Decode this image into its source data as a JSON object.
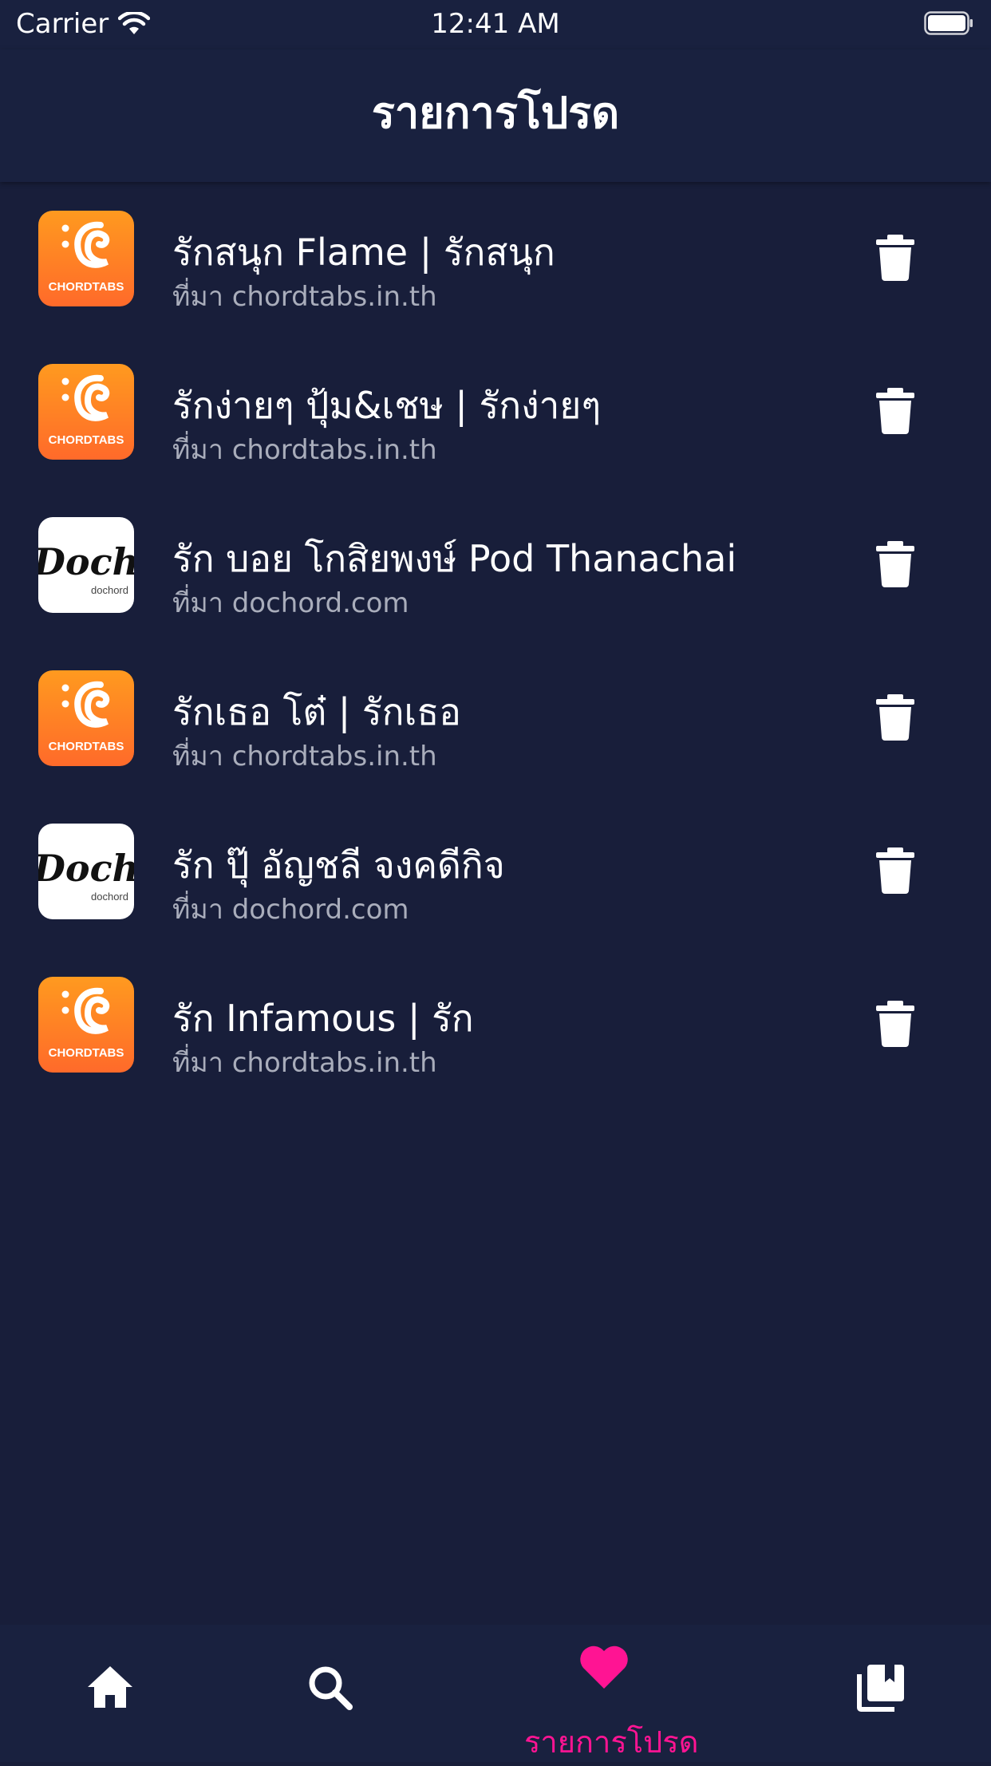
{
  "status_bar": {
    "carrier": "Carrier",
    "time": "12:41 AM"
  },
  "header": {
    "title": "รายการโปรด"
  },
  "favorites": [
    {
      "title": "รักสนุก Flame | รักสนุก",
      "source": "ที่มา chordtabs.in.th",
      "logo": "chordtabs"
    },
    {
      "title": "รักง่ายๆ ปุ้ม&เชษ | รักง่ายๆ",
      "source": "ที่มา chordtabs.in.th",
      "logo": "chordtabs"
    },
    {
      "title": "รัก บอย โกสิยพงษ์ Pod Thanachai",
      "source": "ที่มา dochord.com",
      "logo": "dochord"
    },
    {
      "title": "รักเธอ โต๋ | รักเธอ",
      "source": "ที่มา chordtabs.in.th",
      "logo": "chordtabs"
    },
    {
      "title": "รัก ปุ๊ อัญชลี จงคดีกิจ",
      "source": "ที่มา dochord.com",
      "logo": "dochord"
    },
    {
      "title": "รัก Infamous | รัก",
      "source": "ที่มา chordtabs.in.th",
      "logo": "chordtabs"
    }
  ],
  "logos": {
    "chordtabs": "CHORDTABS",
    "dochord_main": "Dochord",
    "dochord_small": "dochord"
  },
  "tabbar": {
    "items": [
      {
        "icon": "home-icon"
      },
      {
        "icon": "search-icon"
      },
      {
        "icon": "heart-icon",
        "label": "รายการโปรด",
        "active": true
      },
      {
        "icon": "library-icon"
      }
    ]
  },
  "colors": {
    "background": "#181e3a",
    "bar": "#19213f",
    "accent": "#ff1493",
    "orange": "#ff7f24"
  }
}
